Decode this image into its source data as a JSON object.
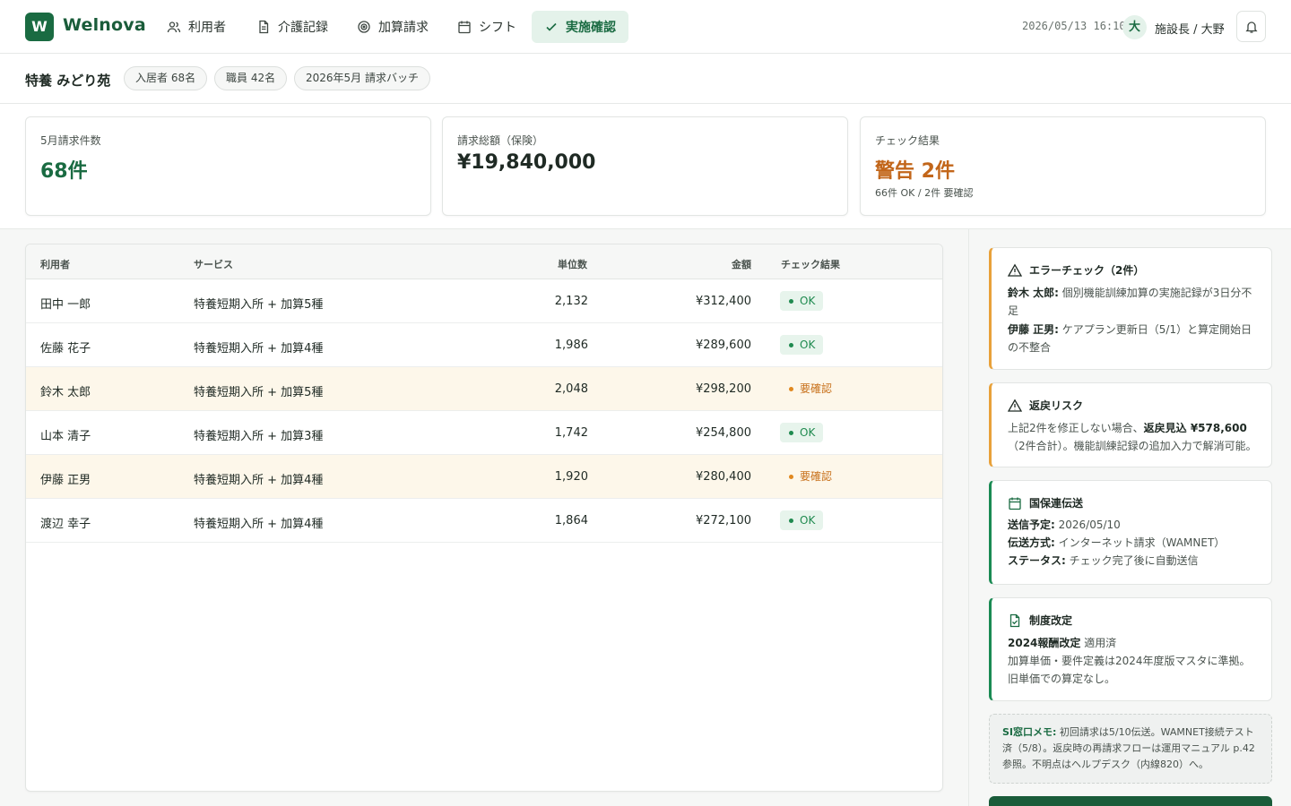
{
  "brand": {
    "logo_letter": "W",
    "name": "Welnova"
  },
  "nav": [
    {
      "label": "利用者",
      "icon": "users-icon"
    },
    {
      "label": "介護記録",
      "icon": "document-icon"
    },
    {
      "label": "加算請求",
      "icon": "target-icon"
    },
    {
      "label": "シフト",
      "icon": "calendar-icon"
    },
    {
      "label": "実施確認",
      "icon": "check-icon",
      "active": true
    }
  ],
  "header": {
    "datetime": "2026/05/13 16:10",
    "avatar_initial": "大",
    "user": "施設長 / 大野"
  },
  "subheader": {
    "facility": "特養 みどり苑",
    "chips": [
      "入居者 68名",
      "職員 42名",
      "2026年5月 請求バッチ"
    ]
  },
  "kpis": [
    {
      "label": "5月請求件数",
      "value": "68件",
      "sub": "",
      "color": "#1a6b42"
    },
    {
      "label": "請求総額（保険）",
      "value": "¥19,840,000",
      "sub": "",
      "color": "#1f2a24"
    },
    {
      "label": "チェック結果",
      "value": "警告 2件",
      "sub": "66件 OK / 2件 要確認",
      "color": "#c2661a"
    }
  ],
  "table": {
    "headers": [
      "利用者",
      "サービス",
      "単位数",
      "金額",
      "チェック結果"
    ],
    "rows": [
      {
        "name": "田中 一郎",
        "service": "特養短期入所 + 加算5種",
        "units": "2,132",
        "amount": "¥312,400",
        "status": "OK",
        "warn": false
      },
      {
        "name": "佐藤 花子",
        "service": "特養短期入所 + 加算4種",
        "units": "1,986",
        "amount": "¥289,600",
        "status": "OK",
        "warn": false
      },
      {
        "name": "鈴木 太郎",
        "service": "特養短期入所 + 加算5種",
        "units": "2,048",
        "amount": "¥298,200",
        "status": "要確認",
        "warn": true
      },
      {
        "name": "山本 清子",
        "service": "特養短期入所 + 加算3種",
        "units": "1,742",
        "amount": "¥254,800",
        "status": "OK",
        "warn": false
      },
      {
        "name": "伊藤 正男",
        "service": "特養短期入所 + 加算4種",
        "units": "1,920",
        "amount": "¥280,400",
        "status": "要確認",
        "warn": true
      },
      {
        "name": "渡辺 幸子",
        "service": "特養短期入所 + 加算4種",
        "units": "1,864",
        "amount": "¥272,100",
        "status": "OK",
        "warn": false
      }
    ]
  },
  "panel": {
    "error_check": {
      "title": "エラーチェック（2件）",
      "items": [
        {
          "key": "鈴木 太郎:",
          "text": " 個別機能訓練加算の実施記録が3日分不",
          "text2": "足"
        },
        {
          "key": "伊藤 正男:",
          "text": " ケアプラン更新日（5/1）と算定開始日",
          "text2": "の不整合"
        }
      ]
    },
    "refund_risk": {
      "title": "返戻リスク",
      "line1_pre": "上記2件を修正しない場合、",
      "line1_key": "返戻見込 ¥578,600",
      "line2": "（2件合計）。機能訓練記録の追加入力で解消可能。"
    },
    "transmission": {
      "title": "国保連伝送",
      "rows": [
        {
          "key": "送信予定:",
          "value": " 2026/05/10"
        },
        {
          "key": "伝送方式:",
          "value": " インターネット請求（WAMNET）"
        },
        {
          "key": "ステータス:",
          "value": " チェック完了後に自動送信"
        }
      ]
    },
    "revision": {
      "title": "制度改定",
      "line1_key": "2024報酬改定",
      "line1_value": " 適用済",
      "line2": "加算単価・要件定義は2024年度版マスタに準拠。",
      "line3": "旧単価での算定なし。"
    },
    "memo": {
      "key": "SI窓口メモ:",
      "text": " 初回請求は5/10伝送。WAMNET接続テスト済（5/8）。返戻時の再請求フローは運用マニュアル p.42参照。不明点はヘルプデスク（内線820）へ。"
    }
  }
}
